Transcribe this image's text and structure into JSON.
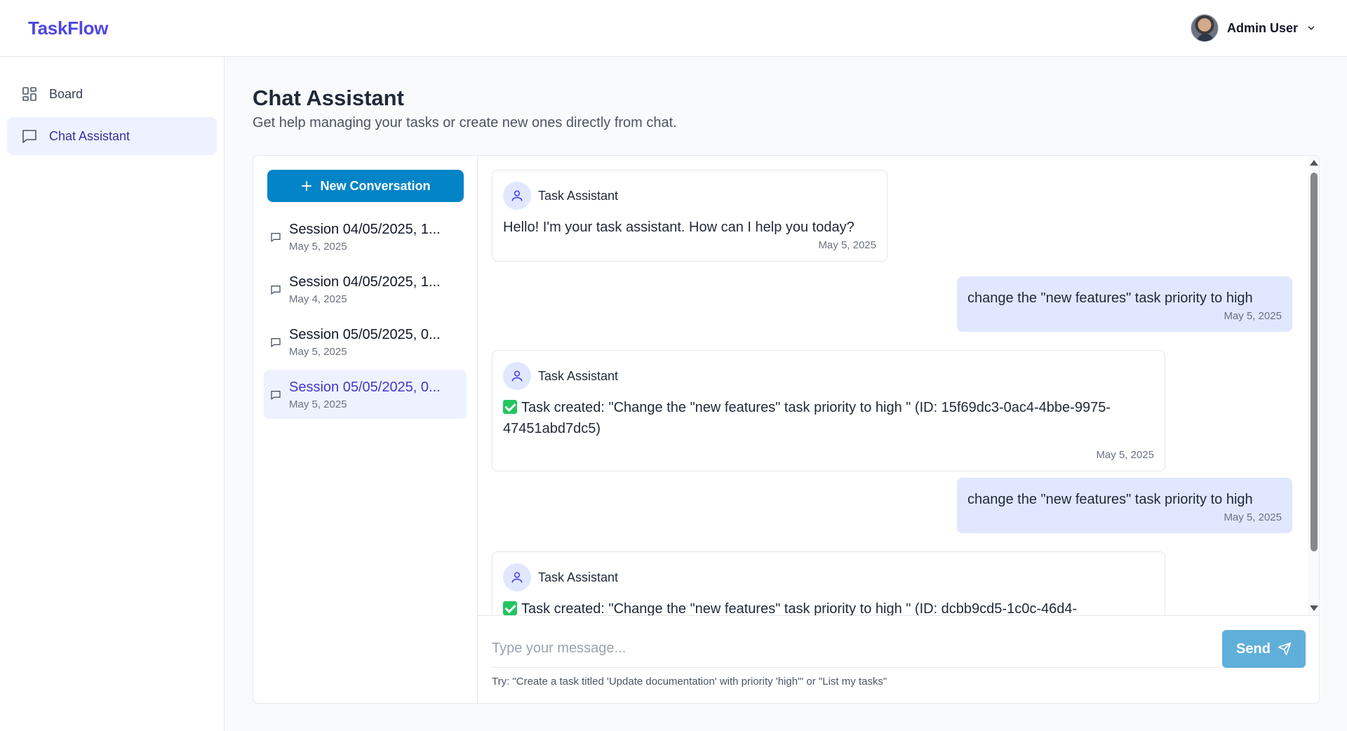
{
  "header": {
    "brand": "TaskFlow",
    "user_name": "Admin User"
  },
  "sidebar": {
    "items": [
      {
        "label": "Board",
        "icon": "grid-icon",
        "active": false
      },
      {
        "label": "Chat Assistant",
        "icon": "chat-icon",
        "active": true
      }
    ]
  },
  "page": {
    "title": "Chat Assistant",
    "subtitle": "Get help managing your tasks or create new ones directly from chat."
  },
  "conversations": {
    "new_button": "New Conversation",
    "sessions": [
      {
        "title": "Session 04/05/2025, 1...",
        "date": "May 5, 2025",
        "active": false
      },
      {
        "title": "Session 04/05/2025, 1...",
        "date": "May 4, 2025",
        "active": false
      },
      {
        "title": "Session 05/05/2025, 0...",
        "date": "May 5, 2025",
        "active": false
      },
      {
        "title": "Session 05/05/2025, 0...",
        "date": "May 5, 2025",
        "active": true
      }
    ]
  },
  "chat": {
    "assistant_name": "Task Assistant",
    "messages": [
      {
        "role": "assistant",
        "text": "Hello! I'm your task assistant. How can I help you today?",
        "time": "May 5, 2025"
      },
      {
        "role": "user",
        "text": "change the \"new features\" task priority to high",
        "time": "May 5, 2025"
      },
      {
        "role": "assistant",
        "text": "Task created: \"Change the \"new features\" task priority to high \" (ID: 15f69dc3-0ac4-4bbe-9975-47451abd7dc5)",
        "time": "May 5, 2025",
        "status_icon": "check-icon"
      },
      {
        "role": "user",
        "text": "change the \"new features\" task priority to high",
        "time": "May 5, 2025"
      },
      {
        "role": "assistant",
        "text": "Task created: \"Change the \"new features\" task priority to high \" (ID: dcbb9cd5-1c0c-46d4-",
        "time": "",
        "status_icon": "check-icon"
      }
    ]
  },
  "composer": {
    "placeholder": "Type your message...",
    "value": "",
    "send_label": "Send",
    "hint": "Try: \"Create a task titled 'Update documentation' with priority 'high'\" or \"List my tasks\""
  },
  "colors": {
    "brand": "#4f46e5",
    "primary_button": "#0284c7",
    "send_button": "#60afd9",
    "active_bg": "#eef2ff",
    "user_bubble": "#e0e7ff",
    "success": "#22c55e"
  }
}
